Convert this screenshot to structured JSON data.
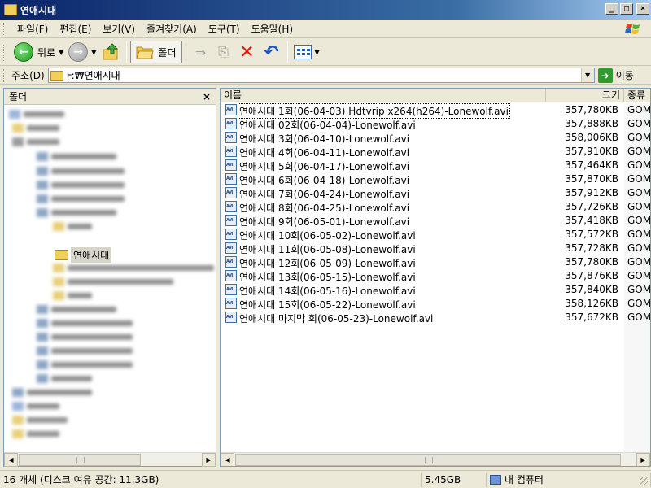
{
  "window": {
    "title": "연애시대"
  },
  "menu": [
    {
      "label": "파일(F)"
    },
    {
      "label": "편집(E)"
    },
    {
      "label": "보기(V)"
    },
    {
      "label": "즐겨찾기(A)"
    },
    {
      "label": "도구(T)"
    },
    {
      "label": "도움말(H)"
    }
  ],
  "toolbar": {
    "back_label": "뒤로",
    "folders_label": "폴더"
  },
  "address": {
    "label": "주소(D)",
    "value": "F:₩연애시대",
    "go_label": "이동"
  },
  "folder_pane": {
    "title": "폴더",
    "selected_folder": "연애시대"
  },
  "file_list": {
    "columns": {
      "name": "이름",
      "size": "크기",
      "type": "종류"
    },
    "files": [
      {
        "name": "연애시대 1회(06-04-03) Hdtvrip x264(h264)-Lonewolf.avi",
        "size": "357,780KB",
        "type": "GOM"
      },
      {
        "name": "연애시대 02회(06-04-04)-Lonewolf.avi",
        "size": "357,888KB",
        "type": "GOM"
      },
      {
        "name": "연애시대 3회(06-04-10)-Lonewolf.avi",
        "size": "358,006KB",
        "type": "GOM"
      },
      {
        "name": "연애시대 4회(06-04-11)-Lonewolf.avi",
        "size": "357,910KB",
        "type": "GOM"
      },
      {
        "name": "연애시대 5회(06-04-17)-Lonewolf.avi",
        "size": "357,464KB",
        "type": "GOM"
      },
      {
        "name": "연애시대 6회(06-04-18)-Lonewolf.avi",
        "size": "357,870KB",
        "type": "GOM"
      },
      {
        "name": "연애시대 7회(06-04-24)-Lonewolf.avi",
        "size": "357,912KB",
        "type": "GOM"
      },
      {
        "name": "연애시대 8회(06-04-25)-Lonewolf.avi",
        "size": "357,726KB",
        "type": "GOM"
      },
      {
        "name": "연애시대 9회(06-05-01)-Lonewolf.avi",
        "size": "357,418KB",
        "type": "GOM"
      },
      {
        "name": "연애시대 10회(06-05-02)-Lonewolf.avi",
        "size": "357,572KB",
        "type": "GOM"
      },
      {
        "name": "연애시대 11회(06-05-08)-Lonewolf.avi",
        "size": "357,728KB",
        "type": "GOM"
      },
      {
        "name": "연애시대 12회(06-05-09)-Lonewolf.avi",
        "size": "357,780KB",
        "type": "GOM"
      },
      {
        "name": "연애시대 13회(06-05-15)-Lonewolf.avi",
        "size": "357,876KB",
        "type": "GOM"
      },
      {
        "name": "연애시대 14회(06-05-16)-Lonewolf.avi",
        "size": "357,840KB",
        "type": "GOM"
      },
      {
        "name": "연애시대 15회(06-05-22)-Lonewolf.avi",
        "size": "358,126KB",
        "type": "GOM"
      },
      {
        "name": "연애시대 마지막 회(06-05-23)-Lonewolf.avi",
        "size": "357,672KB",
        "type": "GOM"
      }
    ]
  },
  "status": {
    "objects": "16 개체 (디스크 여유 공간: 11.3GB)",
    "size": "5.45GB",
    "location": "내 컴퓨터"
  }
}
